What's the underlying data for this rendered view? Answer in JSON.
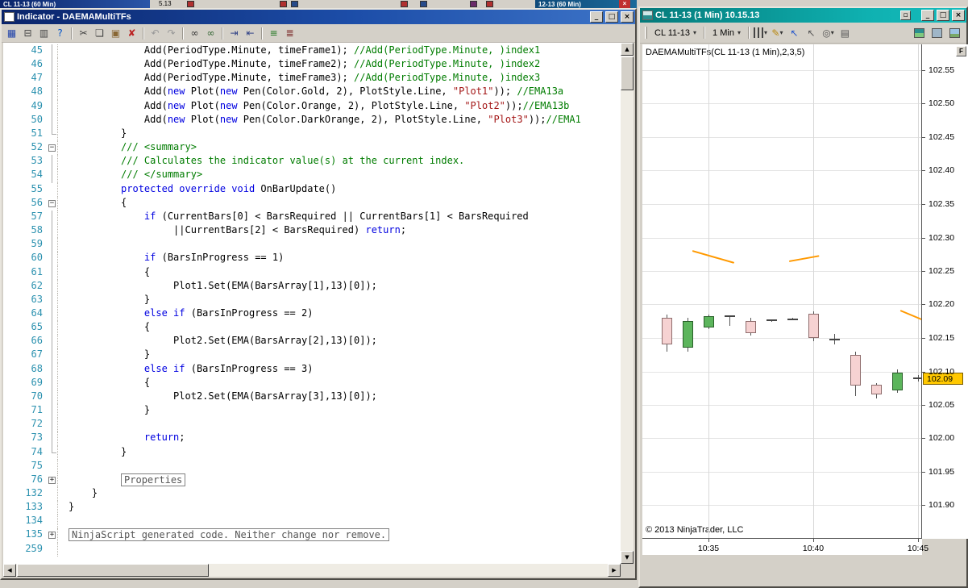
{
  "desktop": {
    "top_left_fragment": "CL 11-13 (60 Min)",
    "top_left_extra": "5.13",
    "top_right_fragment": "12-13 (60 Min)",
    "fragment_close": "×",
    "fragment_colors": [
      "#b03030",
      "#b03030",
      "#264a8a",
      "#b03030",
      "#264a8a",
      "#6a2a6a",
      "#b03030"
    ]
  },
  "editor": {
    "title": "Indicator - DAEMAMultiTFs",
    "buttons": {
      "minimize": "_",
      "maximize": "□",
      "close": "×"
    },
    "toolbar": [
      {
        "name": "save",
        "glyph": "▦",
        "color": "#2244aa"
      },
      {
        "name": "print",
        "glyph": "⊟",
        "color": "#444444"
      },
      {
        "name": "print-preview",
        "glyph": "▥",
        "color": "#444444"
      },
      {
        "name": "help",
        "glyph": "?",
        "color": "#0055cc"
      },
      {
        "name": "sep"
      },
      {
        "name": "cut",
        "glyph": "✂",
        "color": "#444444"
      },
      {
        "name": "copy",
        "glyph": "❏",
        "color": "#444444"
      },
      {
        "name": "paste",
        "glyph": "▣",
        "color": "#886633"
      },
      {
        "name": "delete",
        "glyph": "✘",
        "color": "#bb2222"
      },
      {
        "name": "sep"
      },
      {
        "name": "undo",
        "glyph": "↶",
        "color": "#999999"
      },
      {
        "name": "redo",
        "glyph": "↷",
        "color": "#999999"
      },
      {
        "name": "sep"
      },
      {
        "name": "find",
        "glyph": "∞",
        "color": "#333333"
      },
      {
        "name": "find-in-files",
        "glyph": "∞",
        "color": "#336633"
      },
      {
        "name": "sep"
      },
      {
        "name": "indent",
        "glyph": "⇥",
        "color": "#334488"
      },
      {
        "name": "outdent",
        "glyph": "⇤",
        "color": "#334488"
      },
      {
        "name": "sep"
      },
      {
        "name": "comment",
        "glyph": "≡",
        "color": "#227722"
      },
      {
        "name": "uncomment",
        "glyph": "≣",
        "color": "#772222"
      }
    ],
    "lines": [
      {
        "no": 45,
        "indent": 13,
        "fold": "line",
        "segs": [
          [
            "n",
            "Add(PeriodType.Minute, timeFrame1); "
          ],
          [
            "c",
            "//Add(PeriodType.Minute, )index1"
          ]
        ]
      },
      {
        "no": 46,
        "indent": 13,
        "fold": "line",
        "segs": [
          [
            "n",
            "Add(PeriodType.Minute, timeFrame2); "
          ],
          [
            "c",
            "//Add(PeriodType.Minute, )index2"
          ]
        ]
      },
      {
        "no": 47,
        "indent": 13,
        "fold": "line",
        "segs": [
          [
            "n",
            "Add(PeriodType.Minute, timeFrame3); "
          ],
          [
            "c",
            "//Add(PeriodType.Minute, )index3"
          ]
        ]
      },
      {
        "no": 48,
        "indent": 13,
        "fold": "line",
        "segs": [
          [
            "n",
            "Add("
          ],
          [
            "k",
            "new"
          ],
          [
            "n",
            " Plot("
          ],
          [
            "k",
            "new"
          ],
          [
            "n",
            " Pen(Color.Gold, 2), PlotStyle.Line, "
          ],
          [
            "s",
            "\"Plot1\""
          ],
          [
            "n",
            ")); "
          ],
          [
            "c",
            "//EMA13a"
          ]
        ]
      },
      {
        "no": 49,
        "indent": 13,
        "fold": "line",
        "segs": [
          [
            "n",
            "Add("
          ],
          [
            "k",
            "new"
          ],
          [
            "n",
            " Plot("
          ],
          [
            "k",
            "new"
          ],
          [
            "n",
            " Pen(Color.Orange, 2), PlotStyle.Line, "
          ],
          [
            "s",
            "\"Plot2\""
          ],
          [
            "n",
            "));"
          ],
          [
            "c",
            "//EMA13b"
          ]
        ]
      },
      {
        "no": 50,
        "indent": 13,
        "fold": "line",
        "segs": [
          [
            "n",
            "Add("
          ],
          [
            "k",
            "new"
          ],
          [
            "n",
            " Plot("
          ],
          [
            "k",
            "new"
          ],
          [
            "n",
            " Pen(Color.DarkOrange, 2), PlotStyle.Line, "
          ],
          [
            "s",
            "\"Plot3\""
          ],
          [
            "n",
            "));"
          ],
          [
            "c",
            "//EMA1"
          ]
        ]
      },
      {
        "no": 51,
        "indent": 9,
        "fold": "end",
        "segs": [
          [
            "n",
            "}"
          ]
        ]
      },
      {
        "no": 52,
        "indent": 9,
        "fold": "minus",
        "segs": [
          [
            "c",
            "/// <summary>"
          ]
        ]
      },
      {
        "no": 53,
        "indent": 9,
        "fold": "line",
        "segs": [
          [
            "c",
            "/// Calculates the indicator value(s) at the current index."
          ]
        ]
      },
      {
        "no": 54,
        "indent": 9,
        "fold": "line",
        "segs": [
          [
            "c",
            "/// </summary>"
          ]
        ]
      },
      {
        "no": 55,
        "indent": 9,
        "fold": "",
        "segs": [
          [
            "k",
            "protected override void"
          ],
          [
            "n",
            " OnBarUpdate()"
          ]
        ]
      },
      {
        "no": 56,
        "indent": 9,
        "fold": "minus",
        "segs": [
          [
            "n",
            "{"
          ]
        ]
      },
      {
        "no": 57,
        "indent": 13,
        "fold": "line",
        "segs": [
          [
            "k",
            "if"
          ],
          [
            "n",
            " (CurrentBars[0] < BarsRequired || CurrentBars[1] < BarsRequired"
          ]
        ]
      },
      {
        "no": 58,
        "indent": 18,
        "fold": "line",
        "segs": [
          [
            "n",
            "||CurrentBars[2] < BarsRequired) "
          ],
          [
            "k",
            "return"
          ],
          [
            "n",
            ";"
          ]
        ]
      },
      {
        "no": 59,
        "indent": 0,
        "fold": "line",
        "segs": []
      },
      {
        "no": 60,
        "indent": 13,
        "fold": "line",
        "segs": [
          [
            "k",
            "if"
          ],
          [
            "n",
            " (BarsInProgress == 1)"
          ]
        ]
      },
      {
        "no": 61,
        "indent": 13,
        "fold": "line",
        "segs": [
          [
            "n",
            "{"
          ]
        ]
      },
      {
        "no": 62,
        "indent": 18,
        "fold": "line",
        "segs": [
          [
            "n",
            "Plot1.Set(EMA(BarsArray[1],13)[0]);"
          ]
        ]
      },
      {
        "no": 63,
        "indent": 13,
        "fold": "line",
        "segs": [
          [
            "n",
            "}"
          ]
        ]
      },
      {
        "no": 64,
        "indent": 13,
        "fold": "line",
        "segs": [
          [
            "k",
            "else if"
          ],
          [
            "n",
            " (BarsInProgress == 2)"
          ]
        ]
      },
      {
        "no": 65,
        "indent": 13,
        "fold": "line",
        "segs": [
          [
            "n",
            "{"
          ]
        ]
      },
      {
        "no": 66,
        "indent": 18,
        "fold": "line",
        "segs": [
          [
            "n",
            "Plot2.Set(EMA(BarsArray[2],13)[0]);"
          ]
        ]
      },
      {
        "no": 67,
        "indent": 13,
        "fold": "line",
        "segs": [
          [
            "n",
            "}"
          ]
        ]
      },
      {
        "no": 68,
        "indent": 13,
        "fold": "line",
        "segs": [
          [
            "k",
            "else if"
          ],
          [
            "n",
            " (BarsInProgress == 3)"
          ]
        ]
      },
      {
        "no": 69,
        "indent": 13,
        "fold": "line",
        "segs": [
          [
            "n",
            "{"
          ]
        ]
      },
      {
        "no": 70,
        "indent": 18,
        "fold": "line",
        "segs": [
          [
            "n",
            "Plot2.Set(EMA(BarsArray[3],13)[0]);"
          ]
        ]
      },
      {
        "no": 71,
        "indent": 13,
        "fold": "line",
        "segs": [
          [
            "n",
            "}"
          ]
        ]
      },
      {
        "no": 72,
        "indent": 0,
        "fold": "line",
        "segs": []
      },
      {
        "no": 73,
        "indent": 13,
        "fold": "line",
        "segs": [
          [
            "k",
            "return"
          ],
          [
            "n",
            ";"
          ]
        ]
      },
      {
        "no": 74,
        "indent": 9,
        "fold": "end",
        "segs": [
          [
            "n",
            "}"
          ]
        ]
      },
      {
        "no": 75,
        "indent": 0,
        "fold": "",
        "segs": []
      },
      {
        "no": 76,
        "indent": 9,
        "fold": "plus",
        "boxed": true,
        "segs": [
          [
            "g",
            "Properties"
          ]
        ]
      },
      {
        "no": 132,
        "indent": 4,
        "fold": "",
        "segs": [
          [
            "n",
            "}"
          ]
        ]
      },
      {
        "no": 133,
        "indent": 0,
        "fold": "",
        "segs": [
          [
            "n",
            "}"
          ]
        ]
      },
      {
        "no": 134,
        "indent": 0,
        "fold": "",
        "segs": []
      },
      {
        "no": 135,
        "indent": 0,
        "fold": "plus",
        "boxed": true,
        "segs": [
          [
            "g",
            "NinjaScript generated code. Neither change nor remove."
          ]
        ]
      },
      {
        "no": 259,
        "indent": 0,
        "fold": "",
        "segs": []
      }
    ]
  },
  "chart": {
    "title": "CL 11-13 (1 Min)  10.15.13",
    "buttons": {
      "pin": "▫",
      "minimize": "_",
      "maximize": "□",
      "close": "×"
    },
    "toolbar": {
      "instrument": "CL 11-13",
      "interval": "1 Min",
      "icons_left": [
        {
          "name": "bar-type-icon",
          "css": "mini-candles",
          "caret": true
        },
        {
          "name": "draw-icon",
          "glyph": "✎",
          "color": "#b8860b",
          "caret": true
        },
        {
          "name": "cursor-add-icon",
          "glyph": "↖",
          "color": "#2255cc"
        },
        {
          "name": "cursor-icon",
          "glyph": "↖",
          "color": "#555555"
        },
        {
          "name": "select-icon",
          "glyph": "◎",
          "color": "#555555",
          "caret": true
        },
        {
          "name": "report-icon",
          "glyph": "▤",
          "color": "#555555"
        }
      ],
      "icons_right": [
        {
          "name": "chart-style-icon",
          "css": "mini-style"
        },
        {
          "name": "snapshot-icon",
          "css": "mini-snap"
        },
        {
          "name": "image-icon",
          "css": "mini-image"
        }
      ]
    },
    "indicator_label": "DAEMAMultiTFs(CL 11-13 (1 Min),2,3,5)",
    "copyright": "© 2013 NinjaTrader, LLC",
    "focus_button": "F",
    "last_price_label": "102.09",
    "accent_colors": {
      "up_candle": "#5cb55c",
      "down_candle": "#f6d2d2",
      "ema_plot": "#ff9900",
      "price_badge": "#ffc800"
    }
  },
  "chart_data": {
    "type": "candlestick",
    "title": "DAEMAMultiTFs(CL 11-13 (1 Min),2,3,5)",
    "instrument": "CL 11-13",
    "interval": "1 Min",
    "date": "10.15.13",
    "y_ticks": [
      102.55,
      102.5,
      102.45,
      102.4,
      102.35,
      102.3,
      102.25,
      102.2,
      102.15,
      102.1,
      102.05,
      102.0,
      101.95,
      101.9
    ],
    "ylim": [
      101.85,
      102.59
    ],
    "x_ticks": [
      "10:35",
      "10:40",
      "10:45"
    ],
    "last_price": 102.09,
    "grid": true,
    "legend_position": "none",
    "candles": [
      {
        "time": "10:33",
        "o": 102.18,
        "h": 102.185,
        "l": 102.13,
        "c": 102.14
      },
      {
        "time": "10:34",
        "o": 102.135,
        "h": 102.18,
        "l": 102.13,
        "c": 102.175
      },
      {
        "time": "10:35",
        "o": 102.165,
        "h": 102.185,
        "l": 102.163,
        "c": 102.182
      },
      {
        "time": "10:36",
        "o": 102.182,
        "h": 102.183,
        "l": 102.168,
        "c": 102.182
      },
      {
        "time": "10:37",
        "o": 102.175,
        "h": 102.18,
        "l": 102.153,
        "c": 102.157
      },
      {
        "time": "10:38",
        "o": 102.176,
        "h": 102.178,
        "l": 102.174,
        "c": 102.176
      },
      {
        "time": "10:39",
        "o": 102.178,
        "h": 102.18,
        "l": 102.176,
        "c": 102.178
      },
      {
        "time": "10:40",
        "o": 102.186,
        "h": 102.19,
        "l": 102.145,
        "c": 102.15
      },
      {
        "time": "10:41",
        "o": 102.148,
        "h": 102.156,
        "l": 102.14,
        "c": 102.148
      },
      {
        "time": "10:42",
        "o": 102.125,
        "h": 102.13,
        "l": 102.064,
        "c": 102.079
      },
      {
        "time": "10:43",
        "o": 102.08,
        "h": 102.083,
        "l": 102.06,
        "c": 102.066
      },
      {
        "time": "10:44",
        "o": 102.072,
        "h": 102.103,
        "l": 102.068,
        "c": 102.098
      },
      {
        "time": "10:45",
        "o": 102.09,
        "h": 102.095,
        "l": 102.085,
        "c": 102.09
      }
    ],
    "overlays": [
      {
        "name": "EMA13",
        "color": "#ff9900",
        "segments": [
          {
            "x1": 1.23,
            "p1": 102.28,
            "x2": 3.23,
            "p2": 102.262
          },
          {
            "x1": 5.85,
            "p1": 102.265,
            "x2": 7.27,
            "p2": 102.273
          },
          {
            "x1": 11.15,
            "p1": 102.191,
            "x2": 12.3,
            "p2": 102.176
          }
        ]
      }
    ]
  }
}
